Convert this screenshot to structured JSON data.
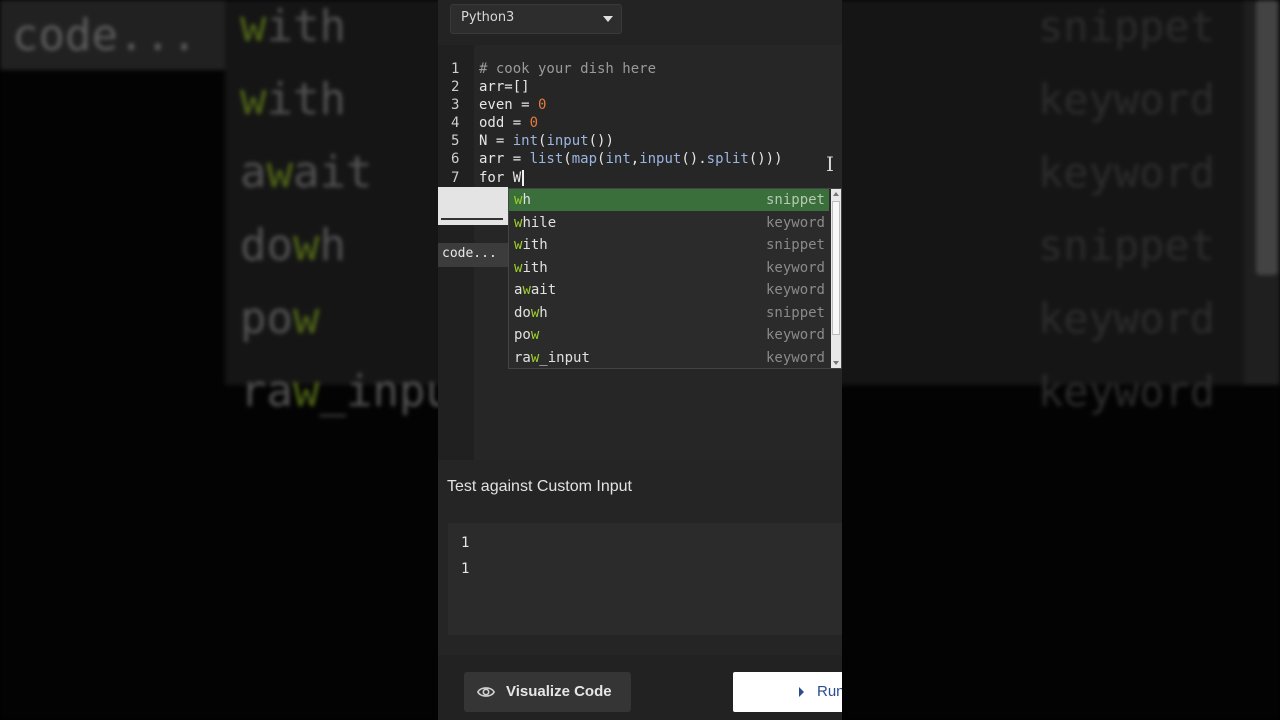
{
  "language": {
    "selected": "Python3"
  },
  "editor": {
    "lines": [
      {
        "num": "1",
        "text": "# cook your dish here"
      },
      {
        "num": "2",
        "text": "arr=[]"
      },
      {
        "num": "3",
        "text": "even = 0"
      },
      {
        "num": "4",
        "text": "odd = 0"
      },
      {
        "num": "5",
        "text": "N = int(input())"
      },
      {
        "num": "6",
        "text": "arr = list(map(int,input().split()))"
      },
      {
        "num": "7",
        "text": "for W"
      }
    ]
  },
  "autocomplete": {
    "items": [
      {
        "word": "wh",
        "kind": "snippet"
      },
      {
        "word": "while",
        "kind": "keyword"
      },
      {
        "word": "with",
        "kind": "snippet"
      },
      {
        "word": "with",
        "kind": "keyword"
      },
      {
        "word": "await",
        "kind": "keyword"
      },
      {
        "word": "dowh",
        "kind": "snippet"
      },
      {
        "word": "pow",
        "kind": "keyword"
      },
      {
        "word": "raw_input",
        "kind": "keyword"
      }
    ]
  },
  "side_tooltip": "code...",
  "custom_input": {
    "title": "Test against Custom Input",
    "lines": [
      "1",
      "1"
    ]
  },
  "buttons": {
    "visualize": "Visualize Code",
    "run": "Run"
  },
  "colors": {
    "selection": "#3a6e3a",
    "match": "#9ed12a",
    "number": "#e27a3f",
    "run_text": "#2a4d8f"
  },
  "background_overlay": {
    "tooltip": "code...",
    "words": [
      "with",
      "with",
      "await",
      "dowh",
      "pow",
      "raw_inpu"
    ],
    "kinds": [
      "snippet",
      "keyword",
      "keyword",
      "snippet",
      "keyword",
      "keyword"
    ]
  }
}
